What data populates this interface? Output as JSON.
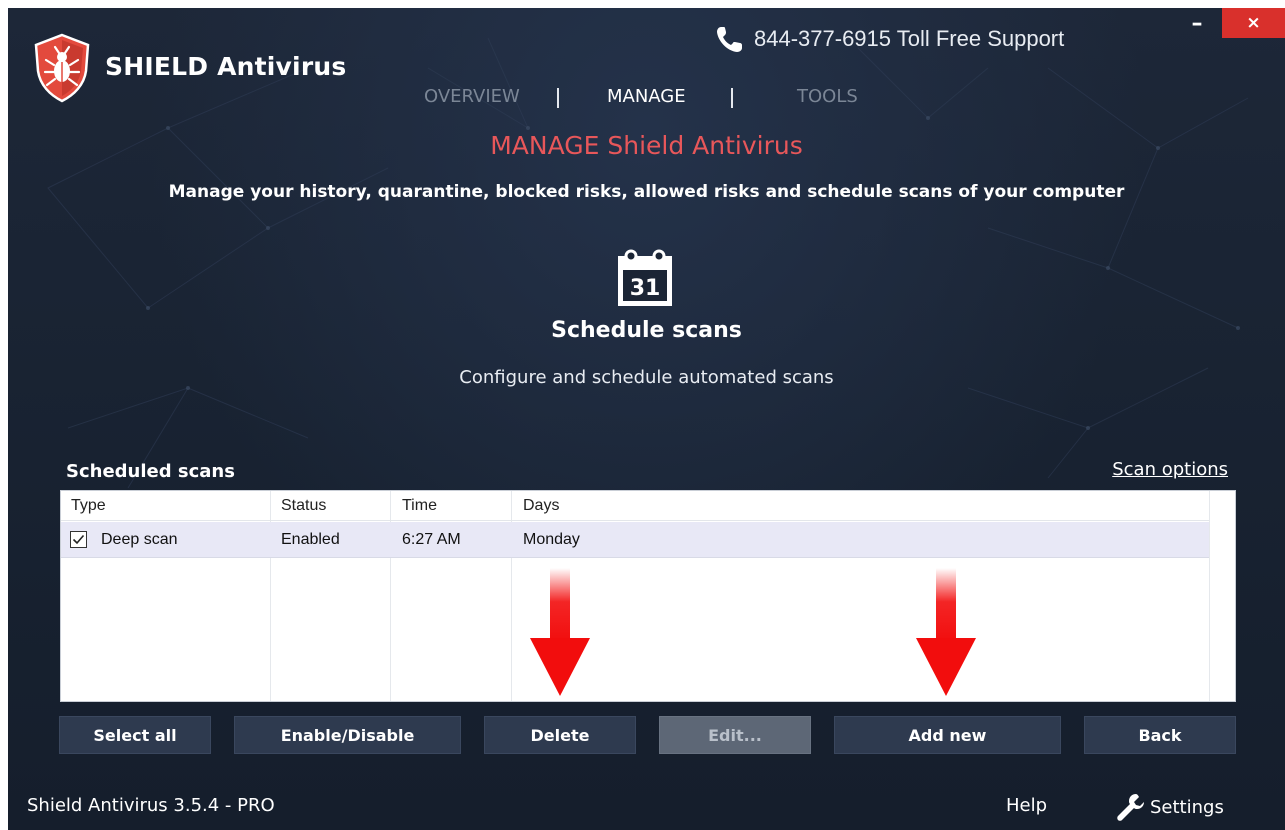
{
  "window": {
    "minimize_glyph": "–",
    "close_glyph": "×"
  },
  "header": {
    "app_title": "SHIELD Antivirus",
    "phone_text": "844-377-6915 Toll Free Support",
    "tabs": [
      {
        "label": "OVERVIEW",
        "active": false
      },
      {
        "label": "MANAGE",
        "active": true
      },
      {
        "label": "TOOLS",
        "active": false
      }
    ]
  },
  "page": {
    "title": "MANAGE Shield Antivirus",
    "subtitle": "Manage your history, quarantine, blocked risks, allowed risks and schedule scans of your computer",
    "calendar_day": "31",
    "section_title": "Schedule scans",
    "section_subtitle": "Configure and schedule automated scans"
  },
  "scheduled": {
    "heading": "Scheduled scans",
    "scan_options_link": "Scan options",
    "columns": [
      "Type",
      "Status",
      "Time",
      "Days"
    ],
    "rows": [
      {
        "checked": true,
        "type": "Deep scan",
        "status": "Enabled",
        "time": "6:27 AM",
        "days": "Monday"
      }
    ]
  },
  "buttons": {
    "select_all": "Select all",
    "enable_disable": "Enable/Disable",
    "delete": "Delete",
    "edit": "Edit...",
    "add_new": "Add new",
    "back": "Back"
  },
  "footer": {
    "version": "Shield Antivirus 3.5.4 - PRO",
    "help": "Help",
    "settings": "Settings"
  },
  "colors": {
    "background": "#1a2434",
    "accent_red": "#e8575a",
    "close_red": "#d9302c",
    "button": "#2e3a4f",
    "button_disabled": "#5d6776",
    "row_selected": "#e8e8f6"
  },
  "icons": {
    "logo": "shield-bug-icon",
    "phone": "phone-icon",
    "calendar": "calendar-icon",
    "checkbox": "checkmark-icon",
    "settings": "wrench-icon",
    "annotation": "red-down-arrow"
  }
}
